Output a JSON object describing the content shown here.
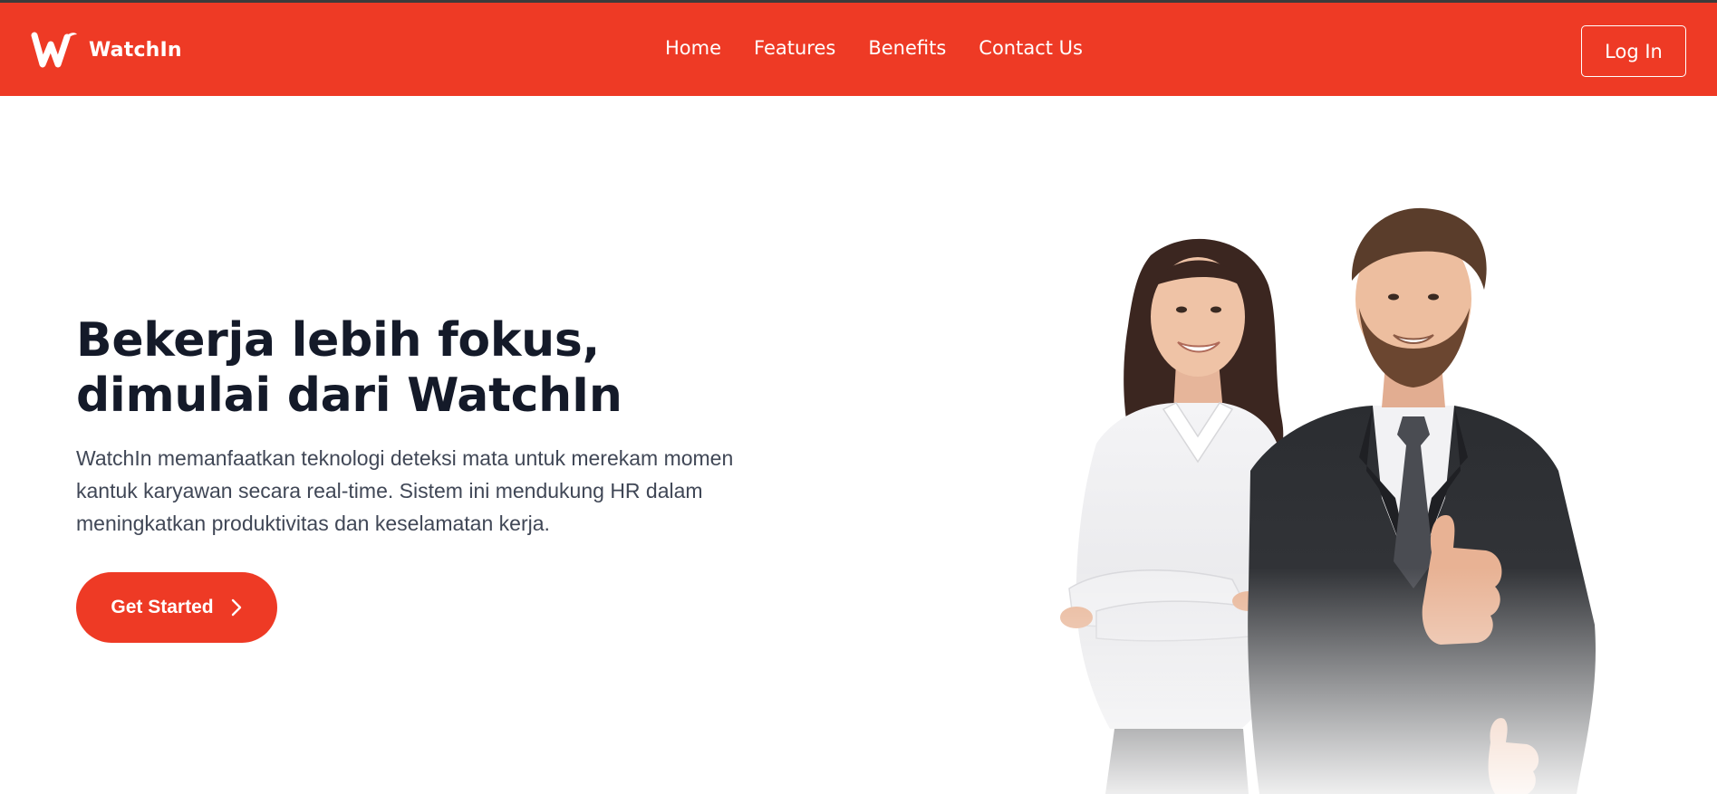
{
  "brand": {
    "name": "WatchIn",
    "accent_color": "#ee3a25",
    "logo_icon": "watchin-logo-icon"
  },
  "nav": {
    "items": [
      {
        "label": "Home"
      },
      {
        "label": "Features"
      },
      {
        "label": "Benefits"
      },
      {
        "label": "Contact Us"
      }
    ],
    "login_label": "Log In"
  },
  "hero": {
    "title_line1": "Bekerja lebih fokus,",
    "title_line2": "dimulai dari WatchIn",
    "description_lines": [
      "WatchIn memanfaatkan teknologi deteksi mata untuk merekam momen",
      "kantuk karyawan secara real-time. Sistem ini mendukung HR dalam",
      "meningkatkan produktivitas dan keselamatan kerja."
    ],
    "cta_label": "Get Started",
    "cta_icon": "chevron-right-icon"
  },
  "illustration": {
    "icon": "business-people-illustration"
  }
}
